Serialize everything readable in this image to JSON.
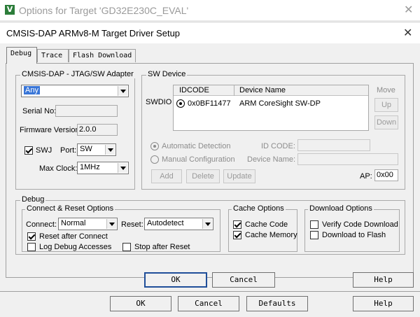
{
  "outer_window": {
    "title": "Options for Target 'GD32E230C_EVAL'",
    "icon_letter": "V",
    "buttons": {
      "ok": "OK",
      "cancel": "Cancel",
      "defaults": "Defaults",
      "help": "Help"
    }
  },
  "dialog": {
    "title": "CMSIS-DAP ARMv8-M Target Driver Setup",
    "tabs": [
      {
        "label": "Debug",
        "active": true
      },
      {
        "label": "Trace",
        "active": false
      },
      {
        "label": "Flash Download",
        "active": false
      }
    ],
    "adapter": {
      "group_label": "CMSIS-DAP - JTAG/SW Adapter",
      "selected": "Any",
      "serial_label": "Serial No:",
      "serial_value": "",
      "firmware_label": "Firmware Version:",
      "firmware_value": "2.0.0",
      "swj_label": "SWJ",
      "swj_checked": true,
      "port_label": "Port:",
      "port_value": "SW",
      "maxclock_label": "Max Clock:",
      "maxclock_value": "1MHz"
    },
    "sw_device": {
      "group_label": "SW Device",
      "swdio_label": "SWDIO",
      "columns": [
        "IDCODE",
        "Device Name"
      ],
      "rows": [
        {
          "idcode": "0x0BF11477",
          "name": "ARM CoreSight SW-DP"
        }
      ],
      "move_label": "Move",
      "up_label": "Up",
      "down_label": "Down",
      "auto_detect_label": "Automatic Detection",
      "manual_config_label": "Manual Configuration",
      "idcode_label": "ID CODE:",
      "device_name_label": "Device Name:",
      "add_label": "Add",
      "delete_label": "Delete",
      "update_label": "Update",
      "ap_label": "AP:",
      "ap_value": "0x00"
    },
    "debug": {
      "group_label": "Debug",
      "connect_reset": {
        "group_label": "Connect & Reset Options",
        "connect_label": "Connect:",
        "connect_value": "Normal",
        "reset_label": "Reset:",
        "reset_value": "Autodetect",
        "reset_after_connect_label": "Reset after Connect",
        "reset_after_connect_checked": true,
        "log_debug_label": "Log Debug Accesses",
        "log_debug_checked": false,
        "stop_after_reset_label": "Stop after Reset",
        "stop_after_reset_checked": false
      },
      "cache": {
        "group_label": "Cache Options",
        "cache_code_label": "Cache Code",
        "cache_code_checked": true,
        "cache_memory_label": "Cache Memory",
        "cache_memory_checked": true
      },
      "download": {
        "group_label": "Download Options",
        "verify_label": "Verify Code Download",
        "verify_checked": false,
        "flash_label": "Download to Flash",
        "flash_checked": false
      }
    },
    "buttons": {
      "ok": "OK",
      "cancel": "Cancel",
      "help": "Help"
    }
  }
}
